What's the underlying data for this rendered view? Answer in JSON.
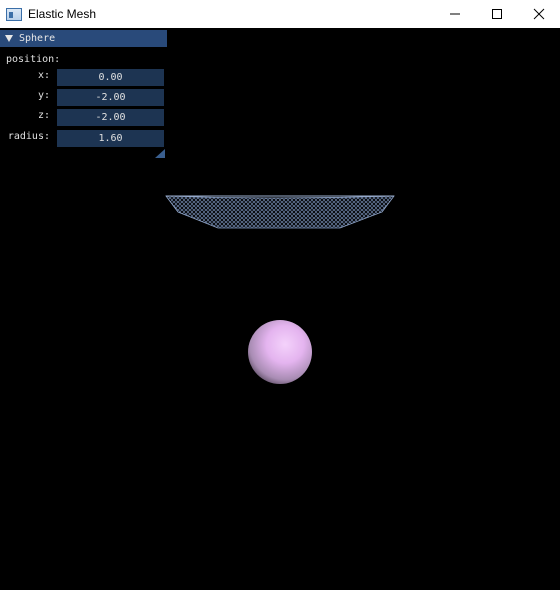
{
  "window": {
    "title": "Elastic Mesh",
    "controls": {
      "minimize": "minimize-icon",
      "maximize": "maximize-icon",
      "close": "close-icon"
    }
  },
  "panel": {
    "header": "Sphere",
    "section_label": "position:",
    "fields": [
      {
        "label": "x:",
        "value": "0.00"
      },
      {
        "label": "y:",
        "value": "-2.00"
      },
      {
        "label": "z:",
        "value": "-2.00"
      },
      {
        "label": "radius:",
        "value": "1.60"
      }
    ]
  },
  "colors": {
    "panel_header": "#294a7a",
    "field_bg": "#1d3452",
    "mesh": "#6f86ad",
    "sphere": "#e6b8f0",
    "background": "#000000"
  }
}
